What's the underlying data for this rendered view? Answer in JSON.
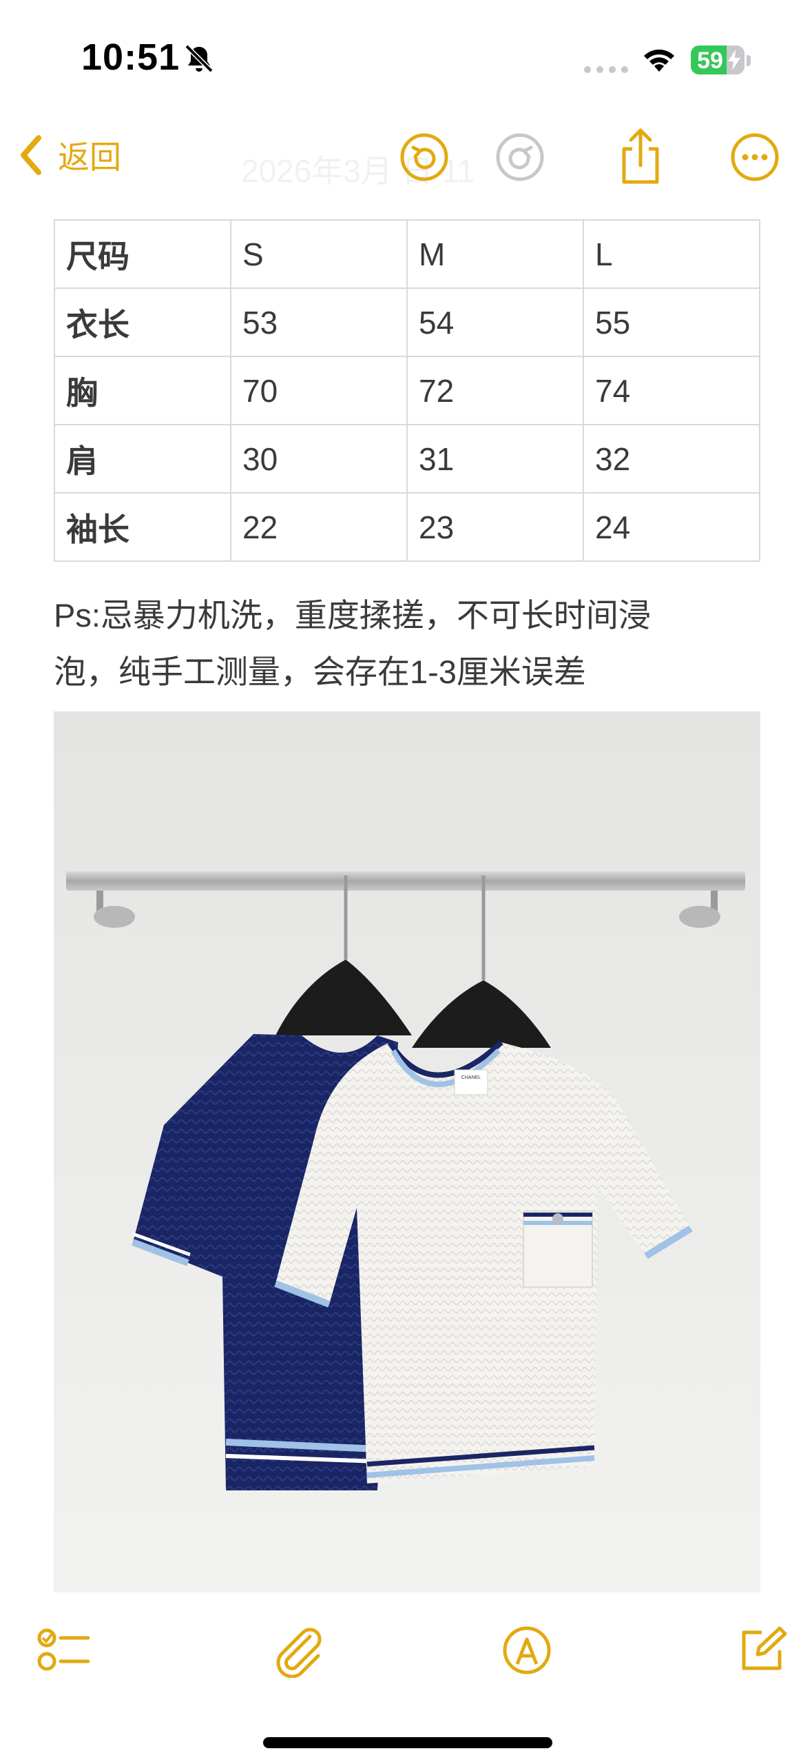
{
  "status_bar": {
    "time": "10:51",
    "battery": "59"
  },
  "nav": {
    "back_label": "返回",
    "date_title": "2026年3月  日  11"
  },
  "table": {
    "rows": [
      [
        "尺码",
        "S",
        "M",
        "L"
      ],
      [
        "衣长",
        "53",
        "54",
        "55"
      ],
      [
        "胸",
        "70",
        "72",
        "74"
      ],
      [
        "肩",
        "30",
        "31",
        "32"
      ],
      [
        "袖长",
        "22",
        "23",
        "24"
      ]
    ]
  },
  "note": {
    "line1": "Ps:忌暴力机洗，重度揉搓，不可长时间浸",
    "line2": "泡，纯手工测量，会存在1-3厘米误差"
  },
  "photo": {
    "tag_brand": "CHANEL"
  },
  "colors": {
    "accent": "#e2aa10",
    "text": "#3a3a3c",
    "table_border": "#d9d9dc"
  },
  "icons": [
    "bell-slash-icon",
    "wifi-icon",
    "battery-icon",
    "chevron-left-icon",
    "undo-icon",
    "redo-icon",
    "share-icon",
    "more-icon",
    "checklist-icon",
    "paperclip-icon",
    "markup-icon",
    "compose-icon"
  ]
}
